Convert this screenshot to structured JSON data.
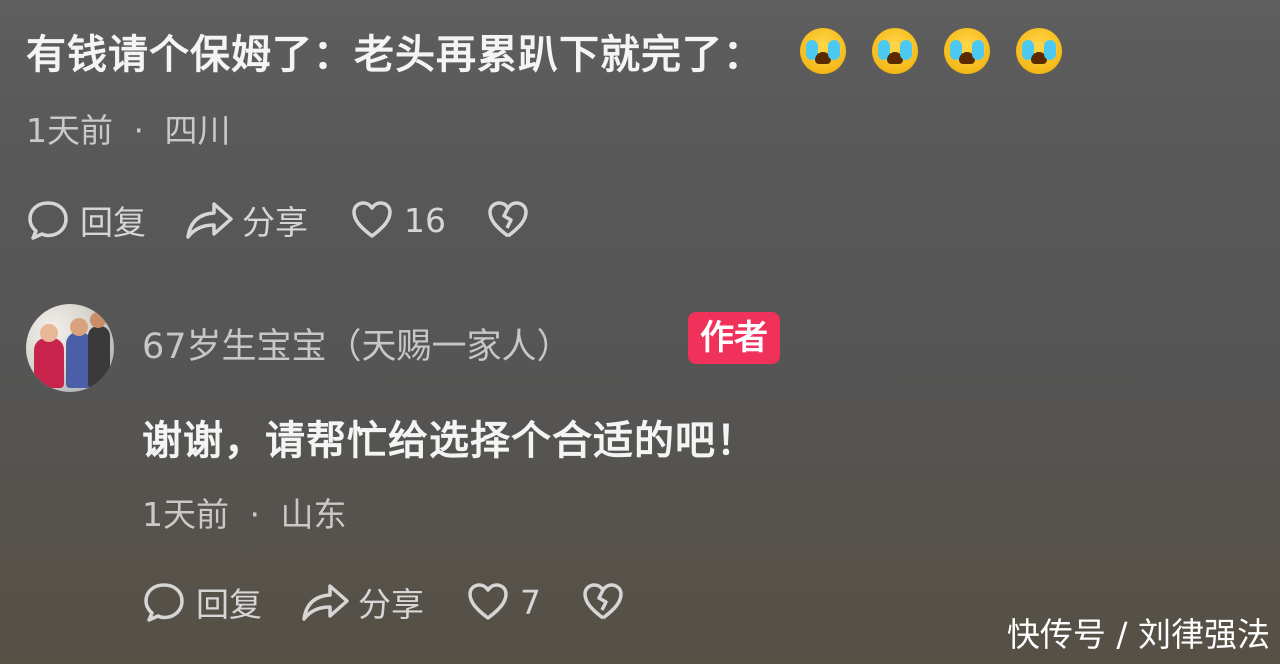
{
  "comment1": {
    "text": "有钱请个保姆了：老头再累趴下就完了：",
    "emojis": [
      "crying-emoji",
      "crying-emoji",
      "crying-emoji",
      "crying-emoji"
    ],
    "time": "1天前",
    "separator": "·",
    "location": "四川",
    "reply_label": "回复",
    "share_label": "分享",
    "like_count": "16"
  },
  "comment2": {
    "username": "67岁生宝宝（天赐一家人）",
    "badge": "作者",
    "text": "谢谢，请帮忙给选择个合适的吧！",
    "time": "1天前",
    "separator": "·",
    "location": "山东",
    "reply_label": "回复",
    "share_label": "分享",
    "like_count": "7"
  },
  "watermark": "快传号 / 刘律强法",
  "colors": {
    "badge": "#f0325a",
    "emoji_tears": "#4cc9f0",
    "emoji_face": "#f5b919"
  }
}
